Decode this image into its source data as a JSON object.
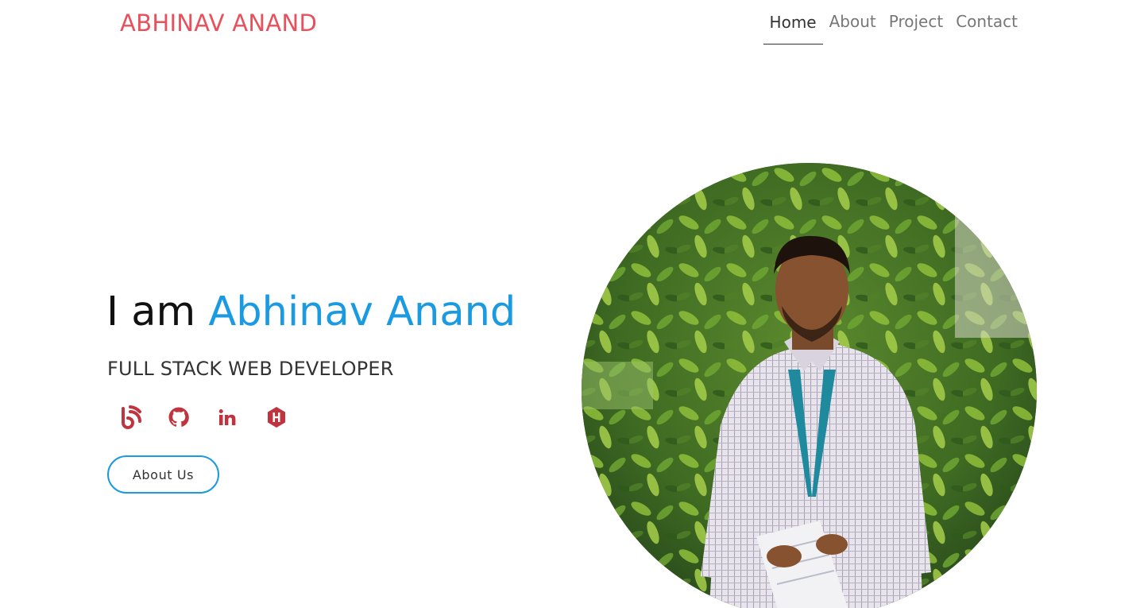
{
  "header": {
    "brand": "ABHINAV ANAND",
    "nav": [
      {
        "label": "Home",
        "active": true
      },
      {
        "label": "About",
        "active": false
      },
      {
        "label": "Project",
        "active": false
      },
      {
        "label": "Contact",
        "active": false
      }
    ]
  },
  "hero": {
    "title_prefix": "I am ",
    "title_name": "Abhinav Anand",
    "subtitle": "FULL STACK WEB DEVELOPER",
    "button_label": "About Us",
    "social_icons": [
      "blog-icon",
      "github-icon",
      "linkedin-icon",
      "hackerrank-icon"
    ]
  },
  "colors": {
    "brand": "#e8505b",
    "accent": "#1a9ae0",
    "icon": "#c0343f"
  }
}
